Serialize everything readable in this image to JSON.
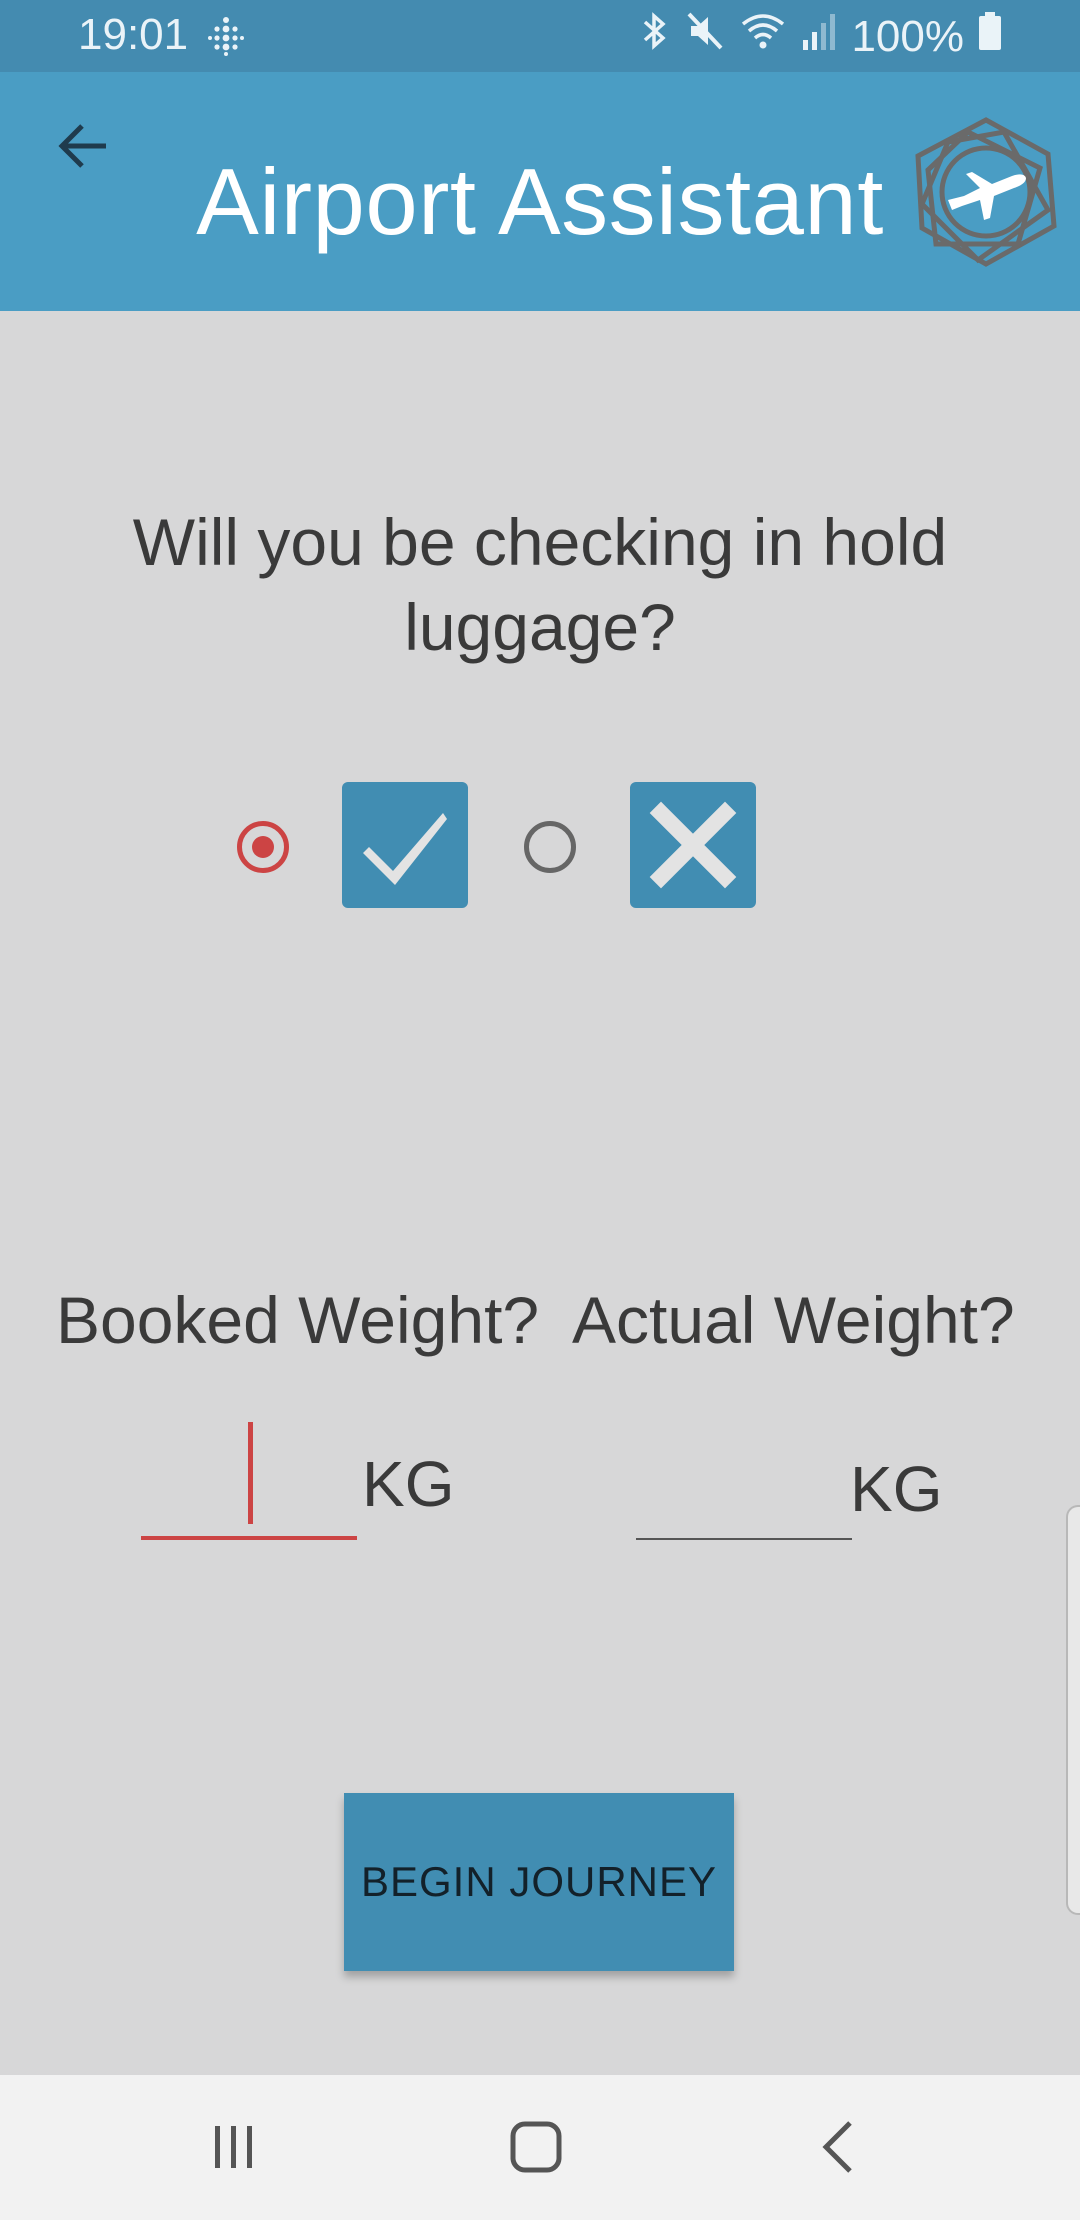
{
  "status_bar": {
    "time": "19:01",
    "battery": "100%"
  },
  "app_bar": {
    "title": "Airport Assistant"
  },
  "question": {
    "text": "Will you be checking in hold luggage?",
    "selected": "yes"
  },
  "weights": {
    "booked_label": "Booked Weight?",
    "actual_label": "Actual Weight?",
    "booked_value": "",
    "actual_value": "",
    "unit": "KG"
  },
  "actions": {
    "begin_label": "BEGIN JOURNEY"
  },
  "colors": {
    "primary": "#4a9dc4",
    "accent": "#cc4444",
    "background": "#d7d7d8"
  }
}
